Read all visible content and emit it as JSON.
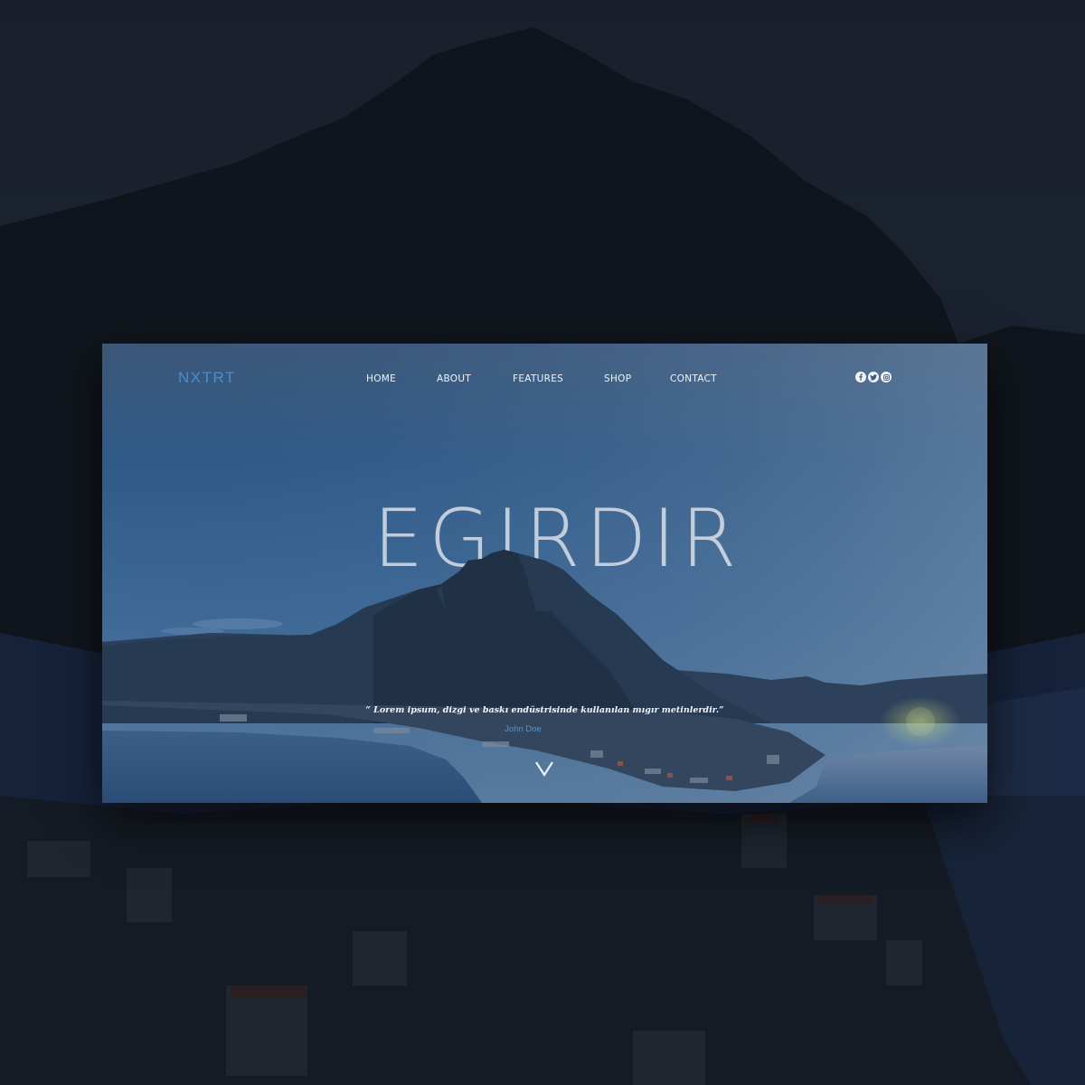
{
  "brand": {
    "logo": "NXTRT"
  },
  "nav": {
    "items": [
      {
        "label": "HOME"
      },
      {
        "label": "ABOUT"
      },
      {
        "label": "FEATURES"
      },
      {
        "label": "SHOP"
      },
      {
        "label": "CONTACT"
      }
    ]
  },
  "social": [
    {
      "icon": "facebook-icon"
    },
    {
      "icon": "twitter-icon"
    },
    {
      "icon": "instagram-icon"
    }
  ],
  "hero": {
    "title": "EGIRDIR",
    "quote": "“ Lorem ipsum, dizgi ve baskı endüstrisinde kullanılan mıgır metinlerdir.”",
    "author": "John Doe",
    "scroll_icon": "chevron-down-icon"
  },
  "colors": {
    "logo": "#4a8ed0",
    "author": "#5e8fc2",
    "nav_text": "#f1f4f8",
    "backdrop": "#141b26"
  }
}
